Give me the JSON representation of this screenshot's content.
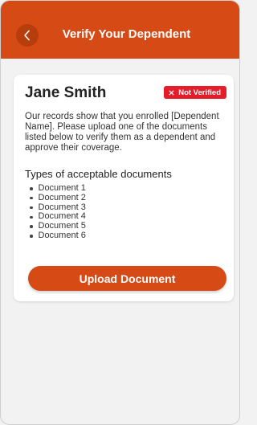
{
  "header": {
    "title": "Verify Your Dependent",
    "back_icon": "chevron-left-icon"
  },
  "dependent": {
    "name": "Jane Smith",
    "status_label": "Not Verified",
    "status_icon": "close-icon",
    "status_color": "#e51d2a",
    "intro_text": "Our records show that you enrolled [Dependent Name]. Please upload one of the documents listed below to verify them as a dependent and approve their coverage."
  },
  "documents": {
    "heading": "Types of acceptable documents",
    "items": [
      {
        "label": "Document 1"
      },
      {
        "label": "Document 2"
      },
      {
        "label": "Document 3"
      },
      {
        "label": "Document 4"
      },
      {
        "label": "Document 5"
      },
      {
        "label": "Document 6"
      }
    ]
  },
  "actions": {
    "upload_label": "Upload Document"
  },
  "colors": {
    "brand": "#d54a15",
    "background": "#f2f2f2"
  }
}
